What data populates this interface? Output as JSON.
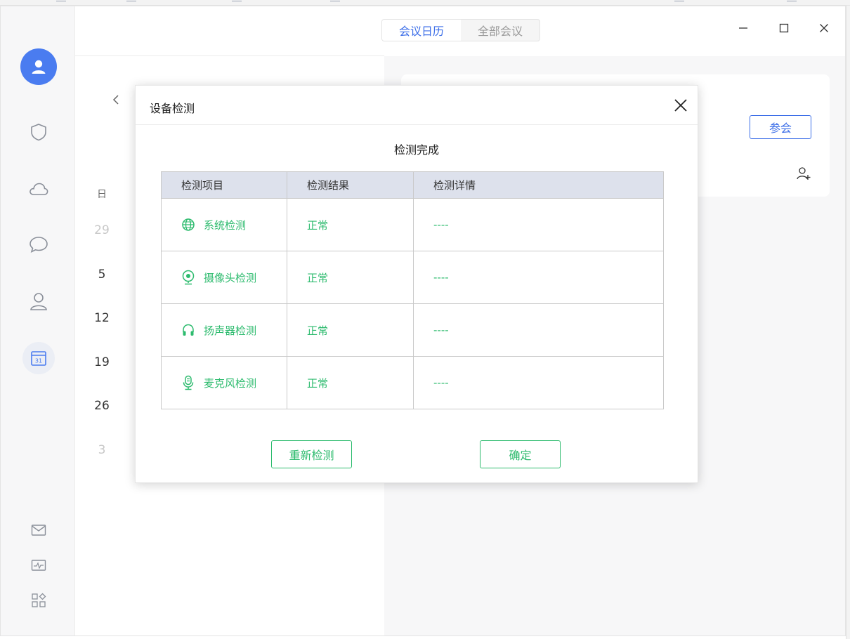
{
  "header": {
    "tabs": [
      {
        "label": "会议日历",
        "active": true
      },
      {
        "label": "全部会议",
        "active": false
      }
    ]
  },
  "calendar": {
    "weekday_label": "日",
    "dates": [
      {
        "value": "29",
        "dim": true
      },
      {
        "value": "5",
        "dim": false
      },
      {
        "value": "12",
        "dim": false
      },
      {
        "value": "19",
        "dim": false
      },
      {
        "value": "26",
        "dim": false
      },
      {
        "value": "3",
        "dim": true
      }
    ]
  },
  "meeting": {
    "join_label": "参会"
  },
  "dialog": {
    "title": "设备检测",
    "status": "检测完成",
    "columns": [
      "检测项目",
      "检测结果",
      "检测详情"
    ],
    "rows": [
      {
        "icon": "globe-icon",
        "item": "系统检测",
        "result": "正常",
        "detail": "----"
      },
      {
        "icon": "webcam-icon",
        "item": "摄像头检测",
        "result": "正常",
        "detail": "----"
      },
      {
        "icon": "headphones-icon",
        "item": "扬声器检测",
        "result": "正常",
        "detail": "----"
      },
      {
        "icon": "microphone-icon",
        "item": "麦克风检测",
        "result": "正常",
        "detail": "----"
      }
    ],
    "retest_label": "重新检测",
    "confirm_label": "确定"
  },
  "colors": {
    "accent": "#3c6ee8",
    "success": "#2dbb6e"
  }
}
